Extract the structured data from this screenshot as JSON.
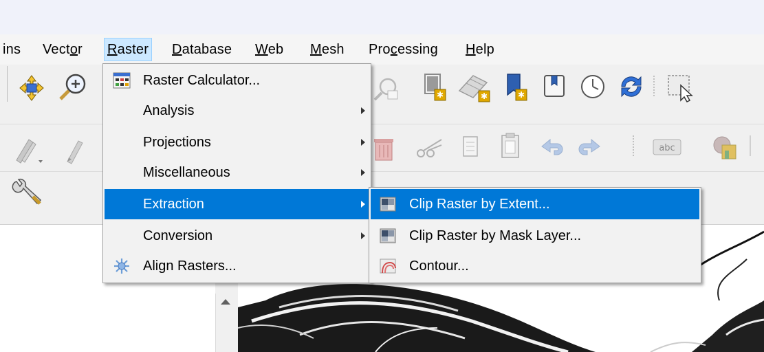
{
  "menubar": {
    "items": [
      {
        "label": "ins",
        "mnemonic": ""
      },
      {
        "label": "Vector",
        "mnemonic": "o"
      },
      {
        "label": "Raster",
        "mnemonic": "R"
      },
      {
        "label": "Database",
        "mnemonic": "D"
      },
      {
        "label": "Web",
        "mnemonic": "W"
      },
      {
        "label": "Mesh",
        "mnemonic": "M"
      },
      {
        "label": "Processing",
        "mnemonic": "c"
      },
      {
        "label": "Help",
        "mnemonic": "H"
      }
    ],
    "active": "Raster"
  },
  "raster_menu": {
    "items": [
      {
        "label": "Raster Calculator...",
        "icon": "raster-calculator-icon",
        "submenu": false
      },
      {
        "label": "Analysis",
        "icon": "",
        "submenu": true
      },
      {
        "label": "Projections",
        "icon": "",
        "submenu": true
      },
      {
        "label": "Miscellaneous",
        "icon": "",
        "submenu": true
      },
      {
        "label": "Extraction",
        "icon": "",
        "submenu": true,
        "highlighted": true
      },
      {
        "label": "Conversion",
        "icon": "",
        "submenu": true
      },
      {
        "label": "Align Rasters...",
        "icon": "align-rasters-icon",
        "submenu": false
      }
    ]
  },
  "extraction_submenu": {
    "items": [
      {
        "label": "Clip Raster by Extent...",
        "icon": "clip-raster-extent-icon",
        "highlighted": true
      },
      {
        "label": "Clip Raster by Mask Layer...",
        "icon": "clip-raster-mask-icon"
      },
      {
        "label": "Contour...",
        "icon": "contour-icon"
      }
    ]
  },
  "toolbar": {
    "row1_icons": [
      "pan-to-selection-icon",
      "zoom-in-icon",
      "identify-icon",
      "new-bookmark-icon",
      "new-spatial-bookmark-icon",
      "show-bookmarks-icon",
      "new-map-view-icon",
      "temporal-controller-icon",
      "refresh-icon",
      "select-features-icon"
    ],
    "row2_icons": [
      "digitize-icon",
      "edit-pencil-icon",
      "delete-selected-icon",
      "cut-features-icon",
      "copy-features-icon",
      "paste-features-icon",
      "undo-icon",
      "redo-icon",
      "label-abc-icon",
      "diagram-icon"
    ],
    "row3_icons": [
      "processing-toolbox-icon"
    ]
  },
  "colors": {
    "highlight": "#0078d7",
    "menu_bg": "#f2f2f2",
    "active_menu_bg": "#cce8ff"
  }
}
